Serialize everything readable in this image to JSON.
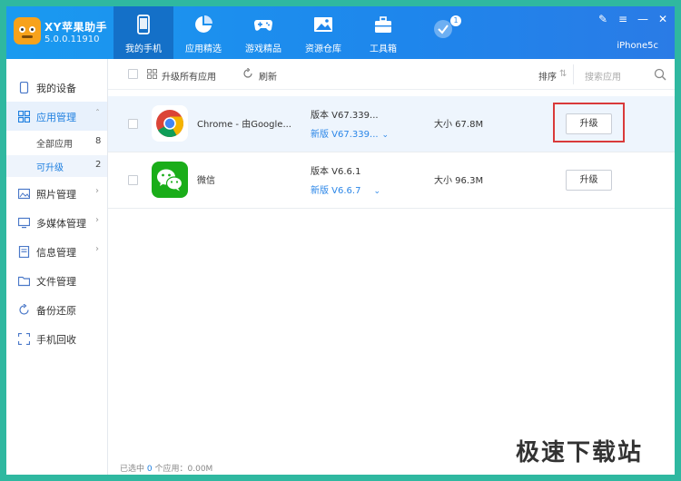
{
  "app": {
    "title": "XY苹果助手",
    "version": "5.0.0.11910",
    "device": "iPhone5c"
  },
  "nav": {
    "tabs": [
      {
        "label": "我的手机",
        "icon": "phone-icon",
        "active": true
      },
      {
        "label": "应用精选",
        "icon": "apps-pie-icon",
        "active": false
      },
      {
        "label": "游戏精品",
        "icon": "gamepad-icon",
        "active": false
      },
      {
        "label": "资源仓库",
        "icon": "image-icon",
        "active": false
      },
      {
        "label": "工具箱",
        "icon": "toolbox-icon",
        "active": false
      },
      {
        "label": "",
        "icon": "check-badge-icon",
        "badge": "1",
        "active": false
      }
    ]
  },
  "sidebar": {
    "items": [
      {
        "label": "我的设备",
        "icon": "device-icon"
      },
      {
        "label": "应用管理",
        "icon": "apps-grid-icon",
        "active": true
      },
      {
        "label": "照片管理",
        "icon": "photo-icon"
      },
      {
        "label": "多媒体管理",
        "icon": "media-icon"
      },
      {
        "label": "信息管理",
        "icon": "message-icon"
      },
      {
        "label": "文件管理",
        "icon": "folder-icon"
      },
      {
        "label": "备份还原",
        "icon": "backup-icon"
      },
      {
        "label": "手机回收",
        "icon": "recycle-icon"
      }
    ],
    "subitems": [
      {
        "label": "全部应用",
        "count": "8"
      },
      {
        "label": "可升级",
        "count": "2",
        "active": true
      }
    ]
  },
  "toolbar": {
    "upgrade_all": "升级所有应用",
    "refresh": "刷新",
    "sort": "排序",
    "search_placeholder": "搜索应用"
  },
  "apps": [
    {
      "name": "Chrome - 由Google...",
      "version": "版本 V67.339...",
      "new_version": "新版 V67.339...",
      "size": "大小 67.8M",
      "button": "升级"
    },
    {
      "name": "微信",
      "version": "版本 V6.6.1",
      "new_version": "新版 V6.6.7",
      "size": "大小 96.3M",
      "button": "升级"
    }
  ],
  "footer": {
    "prefix": "已选中",
    "count": "0",
    "suffix": "个应用：0.00M"
  },
  "watermark": "极速下载站",
  "colors": {
    "header": "#1e86ec",
    "accent": "#1e7fe0",
    "highlight_box": "#d93a3a",
    "background": "#2fb8a0"
  }
}
